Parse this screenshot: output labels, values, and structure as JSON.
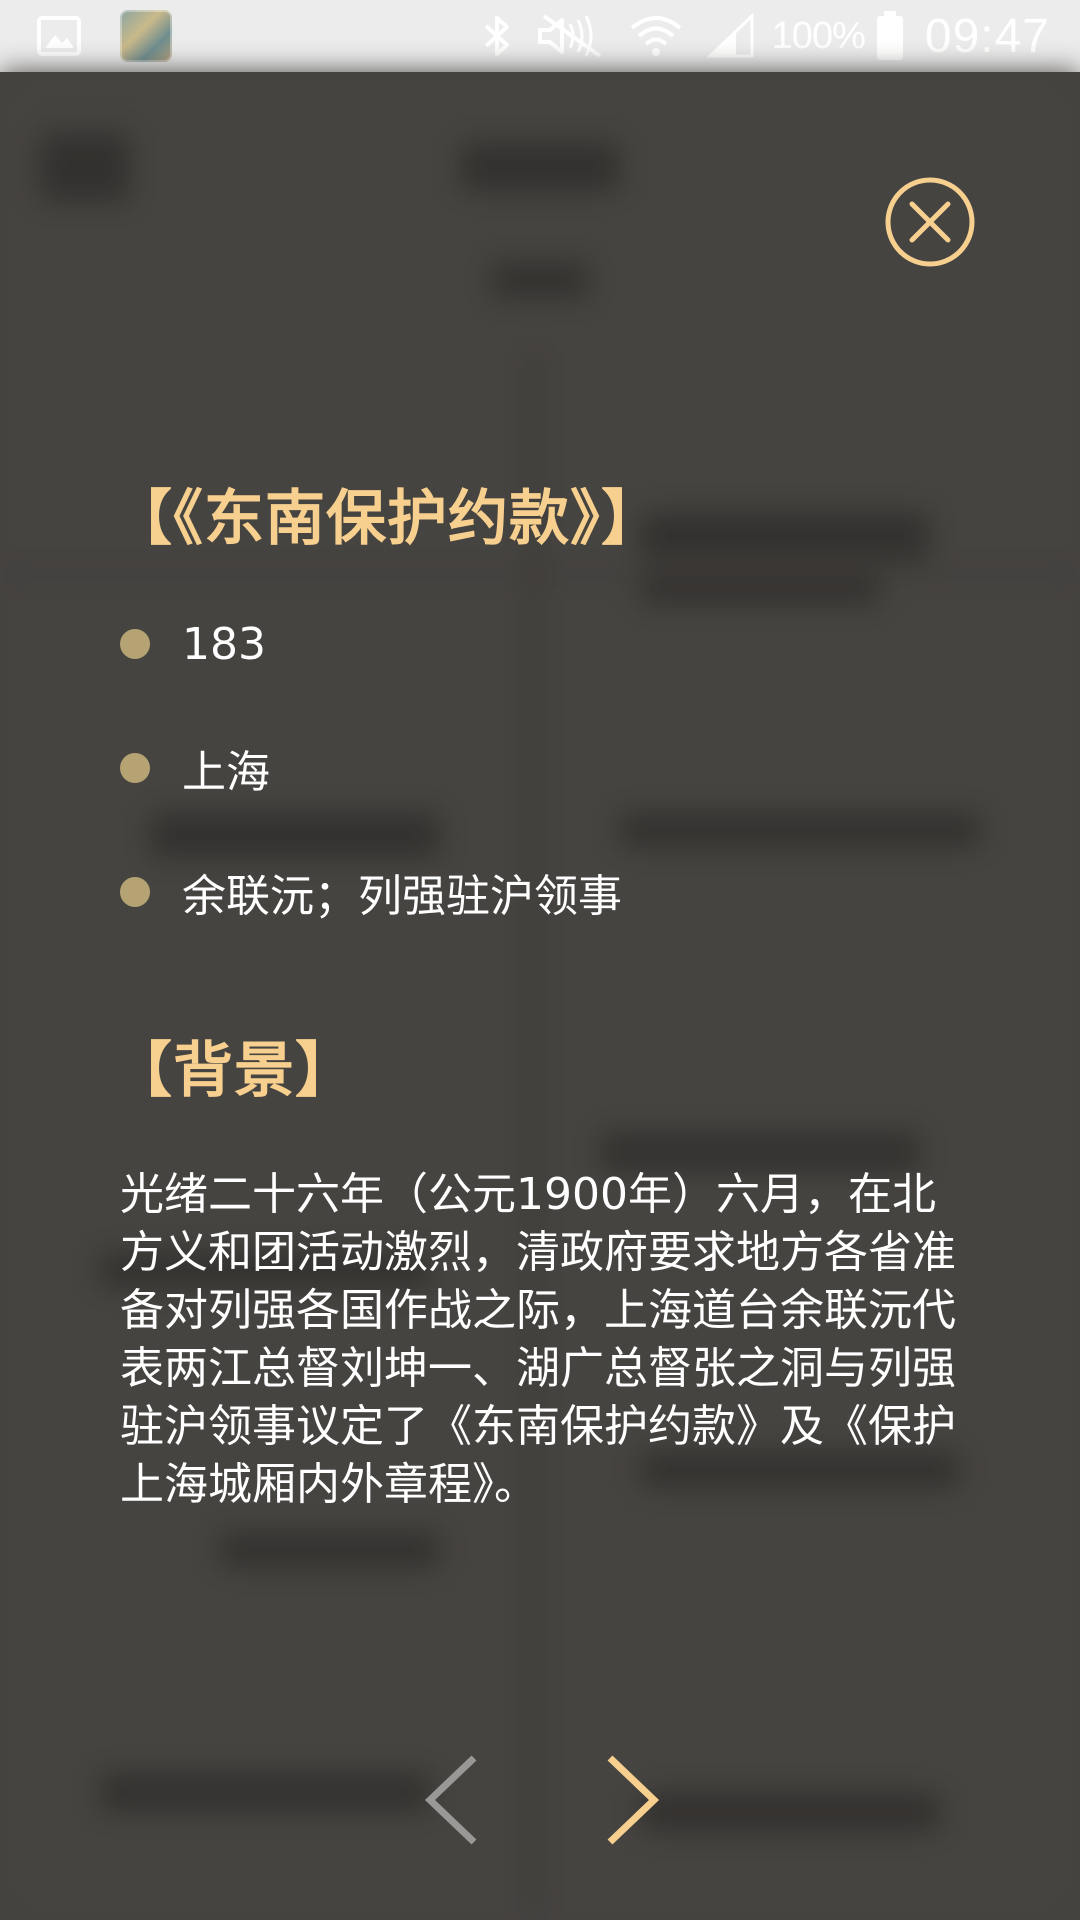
{
  "status_bar": {
    "battery_percent": "100%",
    "time": "09:47",
    "icons": [
      "gallery-icon",
      "app-thumbnail",
      "bluetooth-icon",
      "mute-icon",
      "wifi-icon",
      "signal-icon",
      "battery-icon"
    ]
  },
  "dialog": {
    "title": "【《东南保护约款》】",
    "info_items": [
      {
        "text": "183",
        "icon": "bullet-dot"
      },
      {
        "text": "上海",
        "icon": "bullet-dot"
      },
      {
        "text": "余联沅；列强驻沪领事",
        "icon": "bullet-dot"
      }
    ],
    "background_heading": "【背景】",
    "background_text": "光绪二十六年（公元1900年）六月，在北方义和团活动激烈，清政府要求地方各省准备对列强各国作战之际，上海道台余联沅代表两江总督刘坤一、湖广总督张之洞与列强驻沪领事议定了《东南保护约款》及《保护上海城厢内外章程》。",
    "close_icon": "close-circle-icon",
    "prev_icon": "chevron-left-icon",
    "next_icon": "chevron-right-icon"
  },
  "colors": {
    "accent": "#f7cf8e",
    "bullet": "#b5a374",
    "overlay_bg": "#4a4846",
    "status_bar_bg": "#ececec",
    "prev_disabled": "#9a9896"
  }
}
